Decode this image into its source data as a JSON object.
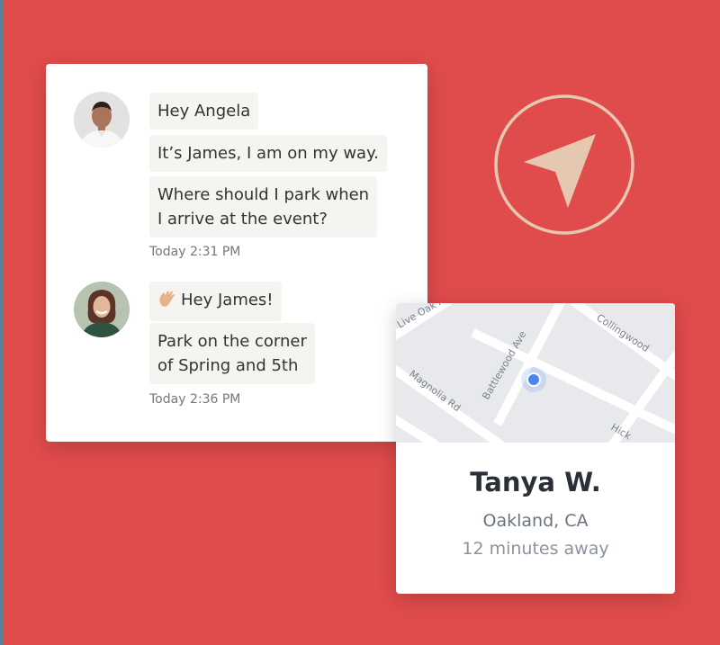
{
  "colors": {
    "background": "#e04b4b",
    "bubble": "#f6f4f1",
    "icon_accent": "#e6c7b1",
    "location_dot": "#4a84f0"
  },
  "chat": {
    "messages_james": {
      "sender_avatar": "avatar-james",
      "bubbles": [
        "Hey Angela",
        "It’s James, I am on my way.",
        "Where should I park when",
        "I arrive at the event?"
      ],
      "time": "Today 2:31 PM"
    },
    "messages_angela": {
      "sender_avatar": "avatar-angela",
      "wave_icon": "waving-hand-icon",
      "bubbles": [
        "Hey James!",
        "Park on the corner",
        "of Spring and 5th"
      ],
      "time": "Today 2:36 PM"
    }
  },
  "send_icon": "navigation-arrow-icon",
  "map": {
    "streets": [
      "Live Oak Av",
      "Collingwood",
      "Battlewood Ave",
      "Magnolia Rd",
      "Hick"
    ]
  },
  "person": {
    "name": "Tanya W.",
    "location": "Oakland, CA",
    "eta": "12 minutes away"
  }
}
